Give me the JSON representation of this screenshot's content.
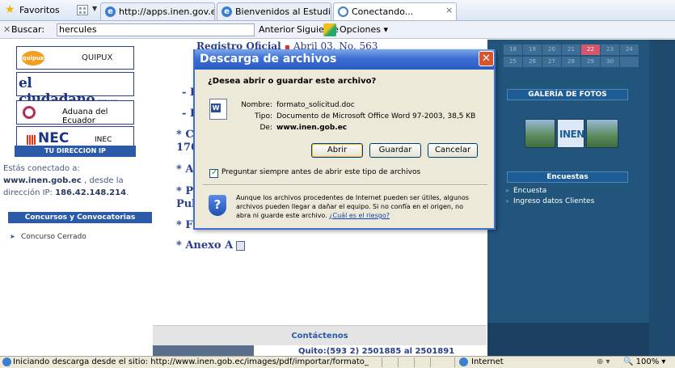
{
  "favbar": {
    "favorites_label": "Favoritos",
    "tabs": [
      {
        "label": "http://apps.inen.gov.ec/..."
      },
      {
        "label": "Bienvenidos al Estudio J..."
      },
      {
        "label": "Conectando..."
      }
    ],
    "tab_close": "×"
  },
  "searchbar": {
    "label": "Buscar:",
    "value": "hercules",
    "prev": "Anterior",
    "next": "Siguiente",
    "options": "Opciones"
  },
  "sidebar": {
    "logos": {
      "quipux_small": "quipux",
      "quipux": "QUIPUX",
      "ciudadano": "el ciudadano",
      "ciudadano_domain": ".gov.ec",
      "aduana": "Aduana del Ecuador",
      "nec": "INEC",
      "nec_sub": "INEC"
    },
    "dir_title": "TU DIRECCION IP",
    "connected_label": "Estás conectado a:",
    "connected_host": "www.inen.gob.ec",
    "from_label": ", desde la dirección IP:",
    "ip": "186.42.148.214",
    "concursos_title": "Concursos y Convocatorias",
    "concursos_item": "Concurso Cerrado"
  },
  "main": {
    "registro": "Registro Oficial",
    "registro_date": "Abril 03, No. 563",
    "anexo": "Anexo A",
    "contact_title": "Contáctenos",
    "phone": "Quito:(593 2) 2501885 al 2501891"
  },
  "right": {
    "cal_row1": [
      "18",
      "19",
      "20",
      "21",
      "22",
      "23",
      "24"
    ],
    "cal_row2": [
      "25",
      "26",
      "27",
      "28",
      "29",
      "30",
      ""
    ],
    "gallery_title": "GALERÍA DE FOTOS",
    "photo_text": "INEN",
    "encuestas_title": "Encuestas",
    "encuestas_items": [
      "Encuesta",
      "Ingreso datos Clientes"
    ]
  },
  "dialog": {
    "title": "Descarga de archivos",
    "question": "¿Desea abrir o guardar este archivo?",
    "name_label": "Nombre:",
    "name_value": "formato_solicitud.doc",
    "type_label": "Tipo:",
    "type_value": "Documento de Microsoft Office Word 97-2003, 38,5 KB",
    "from_label": "De:",
    "from_value": "www.inen.gob.ec",
    "open_button": "Abrir",
    "save_button": "Guardar",
    "cancel_button": "Cancelar",
    "checkbox_label": "Preguntar siempre antes de abrir este tipo de archivos",
    "warning_text": "Aunque los archivos procedentes de Internet pueden ser útiles, algunos archivos pueden llegar a dañar el equipo. Si no confía en el origen, no abra ni guarde este archivo.",
    "warning_link": "¿Cuál es el riesgo?"
  },
  "statusbar": {
    "text": "Iniciando descarga desde el sitio: http://www.inen.gob.ec/images/pdf/importar/formato_",
    "zone": "Internet",
    "zoom": "100%"
  }
}
